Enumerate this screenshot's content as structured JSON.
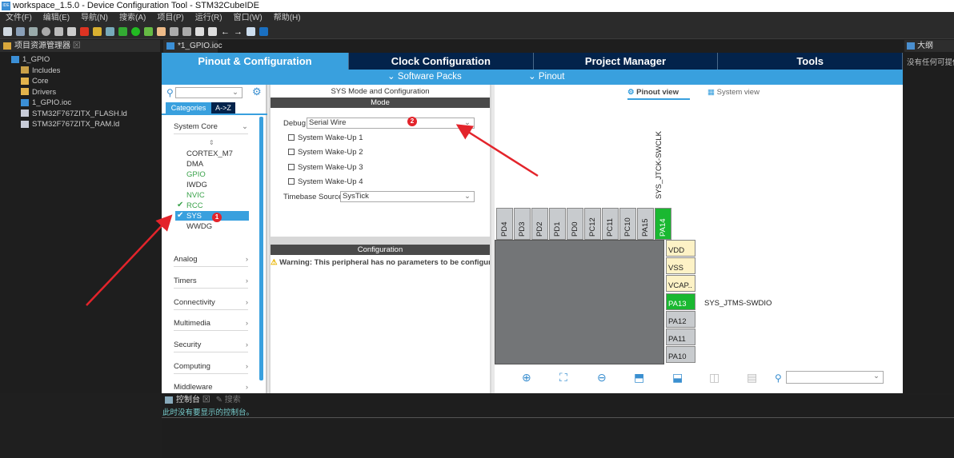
{
  "window": {
    "title": "workspace_1.5.0 - Device Configuration Tool - STM32CubeIDE",
    "logo": "IDE"
  },
  "menu": [
    "文件(F)",
    "编辑(E)",
    "导航(N)",
    "搜索(A)",
    "项目(P)",
    "运行(R)",
    "窗口(W)",
    "帮助(H)"
  ],
  "explorer": {
    "tab": "项目资源管理器",
    "items": [
      {
        "label": "1_GPIO",
        "icon": "project-icon"
      },
      {
        "label": "Includes",
        "icon": "includes-icon"
      },
      {
        "label": "Core",
        "icon": "folder-icon"
      },
      {
        "label": "Drivers",
        "icon": "folder-icon"
      },
      {
        "label": "1_GPIO.ioc",
        "icon": "mx-file-icon"
      },
      {
        "label": "STM32F767ZITX_FLASH.ld",
        "icon": "file-icon"
      },
      {
        "label": "STM32F767ZITX_RAM.ld",
        "icon": "file-icon"
      }
    ]
  },
  "editor": {
    "tab": "*1_GPIO.ioc",
    "main_tabs": [
      "Pinout & Configuration",
      "Clock Configuration",
      "Project Manager",
      "Tools"
    ],
    "sub_menus": [
      "Software Packs",
      "Pinout"
    ],
    "categories": {
      "tab_categories": "Categories",
      "tab_az": "A->Z",
      "system_core": "System Core",
      "system_core_items": [
        {
          "label": "CORTEX_M7",
          "state": "normal"
        },
        {
          "label": "DMA",
          "state": "normal"
        },
        {
          "label": "GPIO",
          "state": "green"
        },
        {
          "label": "IWDG",
          "state": "normal"
        },
        {
          "label": "NVIC",
          "state": "green"
        },
        {
          "label": "RCC",
          "state": "checked"
        },
        {
          "label": "SYS",
          "state": "selected"
        },
        {
          "label": "WWDG",
          "state": "normal"
        }
      ],
      "groups": [
        "Analog",
        "Timers",
        "Connectivity",
        "Multimedia",
        "Security",
        "Computing",
        "Middleware"
      ]
    },
    "mode_panel": {
      "title": "SYS Mode and Configuration",
      "mode_header": "Mode",
      "debug_label": "Debug",
      "debug_value": "Serial Wire",
      "wakeups": [
        "System Wake-Up 1",
        "System Wake-Up 2",
        "System Wake-Up 3",
        "System Wake-Up 4"
      ],
      "timebase_label": "Timebase Source",
      "timebase_value": "SysTick",
      "config_header": "Configuration",
      "warning": "Warning: This peripheral has no parameters to be configured"
    },
    "pinout": {
      "pinout_view": "Pinout view",
      "system_view": "System view",
      "top_pins": [
        "PD4",
        "PD3",
        "PD2",
        "PD1",
        "PD0",
        "PC12",
        "PC11",
        "PC10",
        "PA15",
        "PA14"
      ],
      "top_label": "SYS_JTCK-SWCLK",
      "right_pins": [
        {
          "label": "VDD",
          "type": "power"
        },
        {
          "label": "VSS",
          "type": "power"
        },
        {
          "label": "VCAP..",
          "type": "power"
        },
        {
          "label": "PA13",
          "type": "green"
        },
        {
          "label": "PA12",
          "type": "gray"
        },
        {
          "label": "PA11",
          "type": "gray"
        },
        {
          "label": "PA10",
          "type": "gray"
        }
      ],
      "right_label": "SYS_JTMS-SWDIO"
    }
  },
  "annotations": [
    "1",
    "2"
  ],
  "outline": {
    "tab": "大纲",
    "message": "没有任何可提供"
  },
  "console": {
    "tab": "控制台",
    "tab2": "搜索",
    "message": "此时没有要显示的控制台。"
  },
  "colors": {
    "accent": "#39a0de",
    "navy": "#03234b",
    "green": "#1ab831",
    "arrow": "#e3242b"
  }
}
